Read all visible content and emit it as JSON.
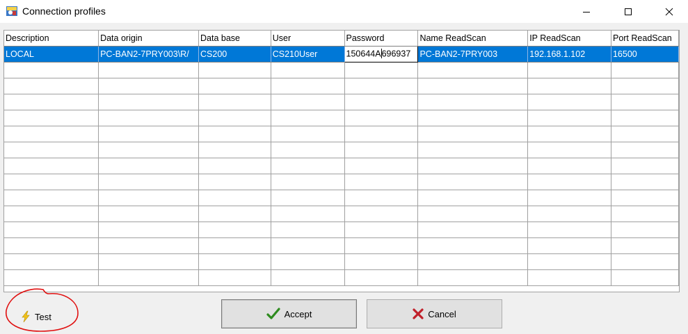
{
  "window": {
    "title": "Connection profiles",
    "app_icon": "app-icon",
    "minimize_icon": "minimize-icon",
    "maximize_icon": "maximize-icon",
    "close_icon": "close-icon"
  },
  "grid": {
    "columns": [
      "Description",
      "Data origin",
      "Data base",
      "User",
      "Password",
      "Name ReadScan",
      "IP ReadScan",
      "Port ReadScan"
    ],
    "rows": [
      [
        "LOCAL",
        "PC-BAN2-7PRY003\\R/",
        "CS200",
        "CS210User",
        "150644A",
        "PC-BAN2-7PRY003",
        "192.168.1.102",
        "16500"
      ]
    ],
    "password_after_caret": "696937",
    "empty_rows": 14
  },
  "buttons": {
    "test": "Test",
    "accept": "Accept",
    "cancel": "Cancel"
  },
  "colors": {
    "selection": "#0078d7",
    "accept_check": "#2e8b1f",
    "cancel_x": "#c0202a",
    "test_bolt": "#f2c318",
    "annotation": "#e01010"
  }
}
